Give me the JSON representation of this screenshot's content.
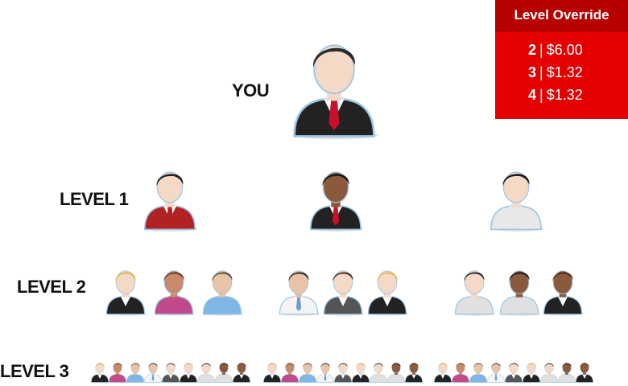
{
  "tree": {
    "root_label": "YOU",
    "levels": [
      {
        "label": "LEVEL 1"
      },
      {
        "label": "LEVEL 2"
      },
      {
        "label": "LEVEL 3"
      }
    ]
  },
  "override": {
    "title": "Level Override",
    "rows": [
      {
        "level": "2",
        "amount": "$6.00"
      },
      {
        "level": "3",
        "amount": "$1.32"
      },
      {
        "level": "4",
        "amount": "$1.32"
      }
    ]
  },
  "avatar_icons": {
    "you": {
      "icon": "businessman-icon",
      "skin": "#f4d9c7",
      "hair": "#2a2a2a",
      "suit": "#222222",
      "shirt": "#ffffff",
      "tie": "#c8102e"
    },
    "level1": [
      {
        "icon": "businesswoman-icon",
        "skin": "#f4d9c7",
        "hair": "#1e1e1e",
        "suit": "#b22222",
        "shirt": "#ffffff",
        "tie": "#b22222"
      },
      {
        "icon": "businessman-icon",
        "skin": "#8b5a3c",
        "hair": "#1a1a1a",
        "suit": "#222222",
        "shirt": "#ffffff",
        "tie": "#c8102e"
      },
      {
        "icon": "woman-icon",
        "skin": "#f4d9c7",
        "hair": "#1a1a1a",
        "suit": "#e8e8e8",
        "shirt": "#e8e8e8",
        "tie": "none"
      }
    ],
    "level2_palette": [
      "waiter-blonde-icon",
      "woman-hat-icon",
      "man-casual-icon",
      "man-shirt-icon",
      "woman-brown-icon",
      "waitress-blonde-icon",
      "man-gray-icon",
      "woman-dark-icon",
      "waitress-dark-icon"
    ]
  }
}
